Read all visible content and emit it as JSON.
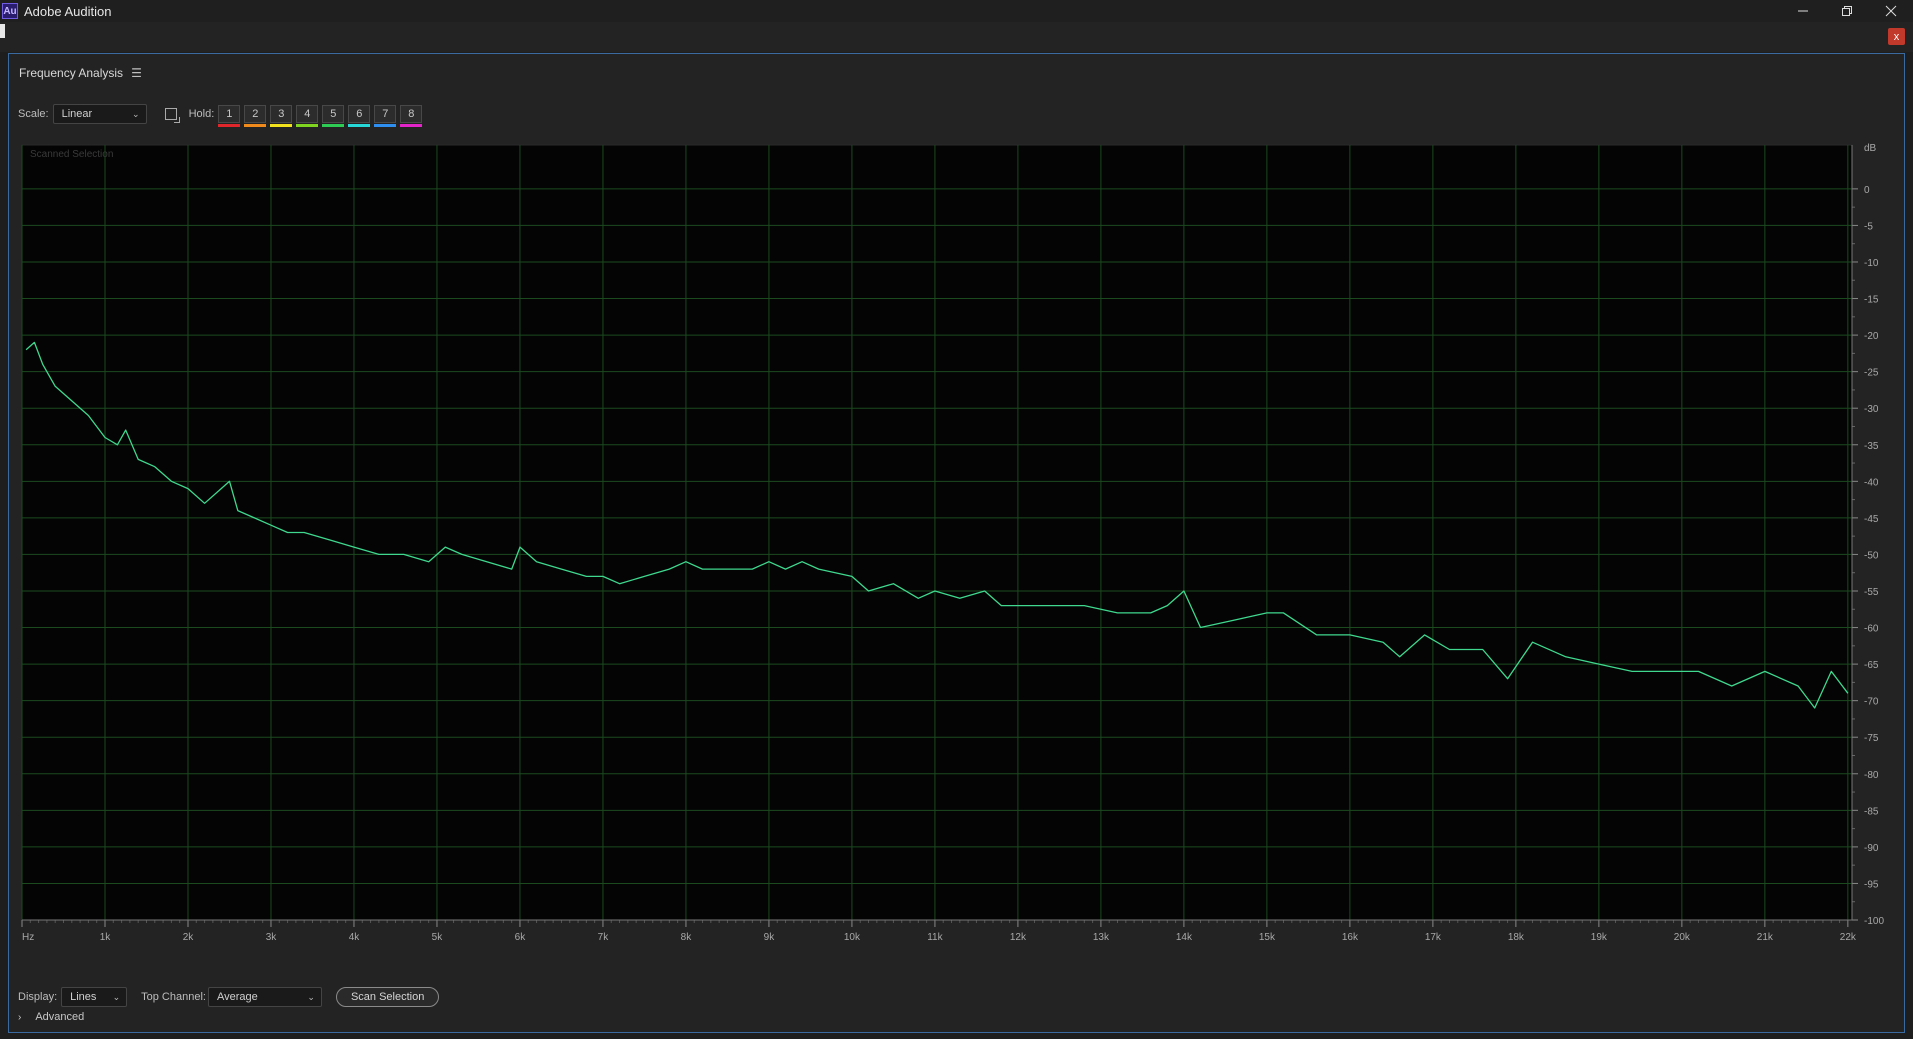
{
  "app": {
    "icon_text": "Au",
    "title": "Adobe Audition",
    "minimize_icon": "minimize-icon",
    "restore_icon": "restore-icon",
    "close_icon": "close-icon",
    "panel_close_label": "x"
  },
  "panel": {
    "title": "Frequency Analysis",
    "menu_icon": "hamburger-menu-icon"
  },
  "toolbar": {
    "scale_label": "Scale:",
    "scale_value": "Linear",
    "hold_label": "Hold:",
    "hold_buttons": [
      {
        "label": "1",
        "color": "#e0262b"
      },
      {
        "label": "2",
        "color": "#f08a1c"
      },
      {
        "label": "3",
        "color": "#f2e21e"
      },
      {
        "label": "4",
        "color": "#7fd51f"
      },
      {
        "label": "5",
        "color": "#2ecc55"
      },
      {
        "label": "6",
        "color": "#27d8d8"
      },
      {
        "label": "7",
        "color": "#2e8ff0"
      },
      {
        "label": "8",
        "color": "#e324c9"
      }
    ]
  },
  "bottom": {
    "display_label": "Display:",
    "display_value": "Lines",
    "channel_label": "Top Channel:",
    "channel_value": "Average",
    "scan_button": "Scan Selection",
    "advanced_label": "Advanced"
  },
  "chart_data": {
    "type": "line",
    "overlay_text": "Scanned Selection",
    "line_color": "#3fd88e",
    "grid_color": "#1b4a1f",
    "xlabel": "",
    "ylabel": "dB",
    "x_ticks": [
      "Hz",
      "1k",
      "2k",
      "3k",
      "4k",
      "5k",
      "6k",
      "7k",
      "8k",
      "9k",
      "10k",
      "11k",
      "12k",
      "13k",
      "14k",
      "15k",
      "16k",
      "17k",
      "18k",
      "19k",
      "20k",
      "21k",
      "22k"
    ],
    "y_ticks": [
      "0",
      "-5",
      "-10",
      "-15",
      "-20",
      "-25",
      "-30",
      "-35",
      "-40",
      "-45",
      "-50",
      "-55",
      "-60",
      "-65",
      "-70",
      "-75",
      "-80",
      "-85",
      "-90",
      "-95",
      "-100"
    ],
    "y_unit": "dB",
    "xlim": [
      0,
      22050
    ],
    "ylim": [
      -100,
      6
    ],
    "series": [
      {
        "x": [
          50,
          150,
          250,
          400,
          600,
          800,
          1000,
          1150,
          1250,
          1400,
          1600,
          1800,
          2000,
          2200,
          2400,
          2500,
          2600,
          2800,
          3000,
          3200,
          3400,
          3700,
          4000,
          4300,
          4600,
          4900,
          5100,
          5300,
          5600,
          5900,
          6000,
          6200,
          6500,
          6800,
          7000,
          7200,
          7500,
          7800,
          8000,
          8200,
          8500,
          8800,
          9000,
          9200,
          9400,
          9600,
          10000,
          10200,
          10500,
          10800,
          11000,
          11300,
          11600,
          11800,
          12000,
          12400,
          12800,
          13200,
          13600,
          13800,
          14000,
          14200,
          14600,
          15000,
          15200,
          15600,
          16000,
          16400,
          16600,
          16900,
          17200,
          17600,
          17900,
          18200,
          18600,
          19000,
          19400,
          19800,
          20200,
          20600,
          21000,
          21400,
          21600,
          21800,
          22000
        ],
        "values": [
          -22,
          -21,
          -24,
          -27,
          -29,
          -31,
          -34,
          -35,
          -33,
          -37,
          -38,
          -40,
          -41,
          -43,
          -41,
          -40,
          -44,
          -45,
          -46,
          -47,
          -47,
          -48,
          -49,
          -50,
          -50,
          -51,
          -49,
          -50,
          -51,
          -52,
          -49,
          -51,
          -52,
          -53,
          -53,
          -54,
          -53,
          -52,
          -51,
          -52,
          -52,
          -52,
          -51,
          -52,
          -51,
          -52,
          -53,
          -55,
          -54,
          -56,
          -55,
          -56,
          -55,
          -57,
          -57,
          -57,
          -57,
          -58,
          -58,
          -57,
          -55,
          -60,
          -59,
          -58,
          -58,
          -61,
          -61,
          -62,
          -64,
          -61,
          -63,
          -63,
          -67,
          -62,
          -64,
          -65,
          -66,
          -66,
          -66,
          -68,
          -66,
          -68,
          -71,
          -66,
          -69
        ]
      }
    ]
  }
}
